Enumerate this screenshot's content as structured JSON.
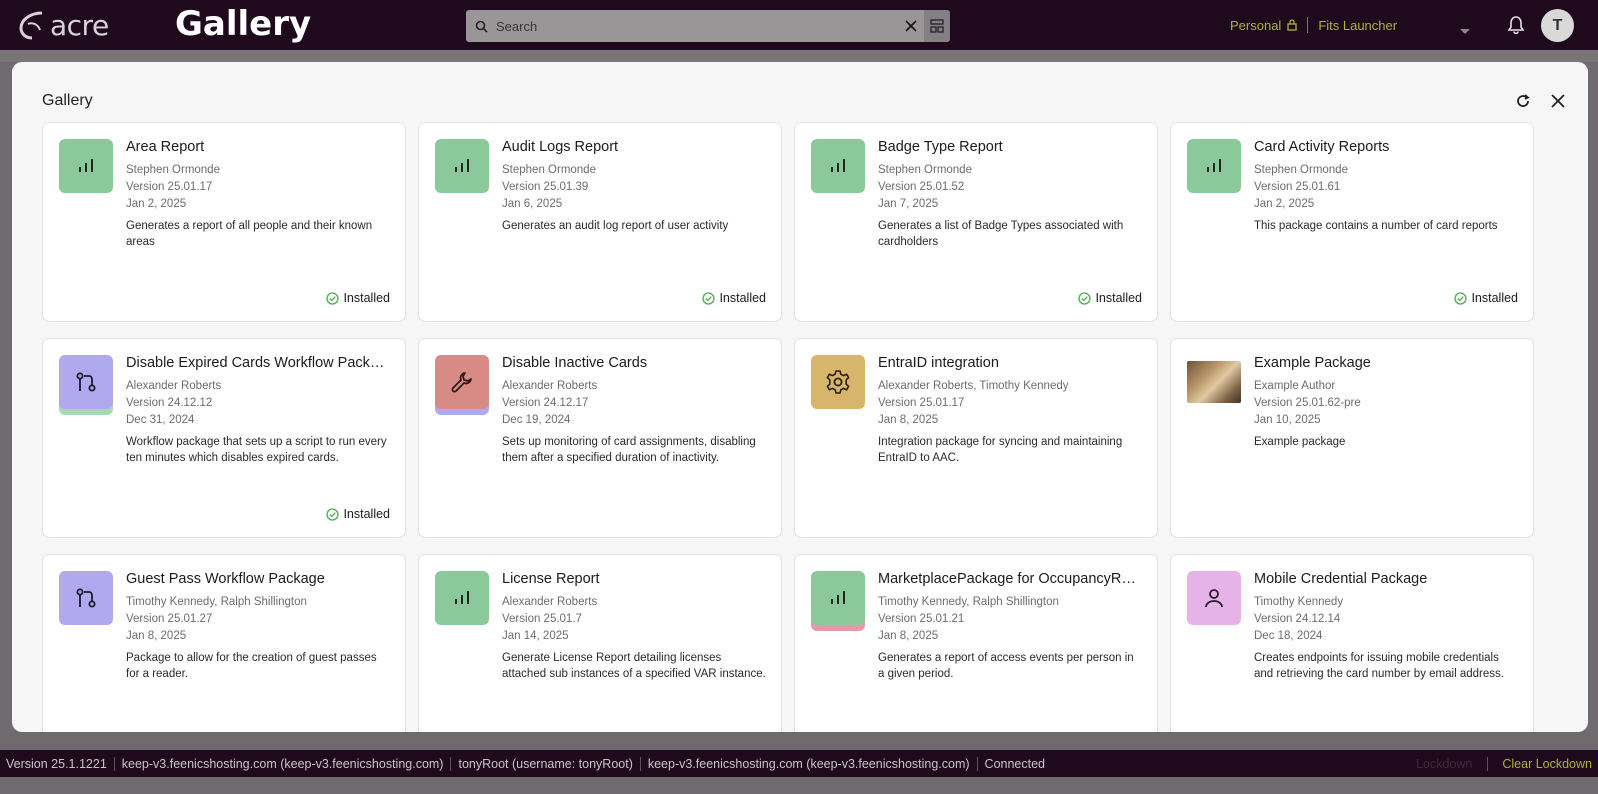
{
  "app": {
    "logo_text": "acre",
    "page_heading": "Gallery"
  },
  "search": {
    "placeholder": "Search",
    "value": ""
  },
  "tenant": {
    "scope": "Personal",
    "name": "Fits Launcher"
  },
  "user": {
    "initial": "T"
  },
  "modal": {
    "title": "Gallery"
  },
  "cards": [
    {
      "title": "Area Report",
      "author": "Stephen Ormonde",
      "version": "Version 25.01.17",
      "date": "Jan 2, 2025",
      "description": "Generates a report of all people and their known areas",
      "status": "Installed",
      "icon": "chart-bars-icon",
      "color": "#8cc99a",
      "stack_color": ""
    },
    {
      "title": "Audit Logs Report",
      "author": "Stephen Ormonde",
      "version": "Version 25.01.39",
      "date": "Jan 6, 2025",
      "description": "Generates an audit log report of user activity",
      "status": "Installed",
      "icon": "chart-bars-icon",
      "color": "#8cc99a",
      "stack_color": ""
    },
    {
      "title": "Badge Type Report",
      "author": "Stephen Ormonde",
      "version": "Version 25.01.52",
      "date": "Jan 7, 2025",
      "description": "Generates a list of Badge Types associated with cardholders",
      "status": "Installed",
      "icon": "chart-bars-icon",
      "color": "#8cc99a",
      "stack_color": ""
    },
    {
      "title": "Card Activity Reports",
      "author": "Stephen Ormonde",
      "version": "Version 25.01.61",
      "date": "Jan 2, 2025",
      "description": "This package contains a number of card reports",
      "status": "Installed",
      "icon": "chart-bars-icon",
      "color": "#8cc99a",
      "stack_color": ""
    },
    {
      "title": "Disable Expired Cards Workflow Pack…",
      "author": "Alexander Roberts",
      "version": "Version 24.12.12",
      "date": "Dec 31, 2024",
      "description": "Workflow package that sets up a script to run every ten minutes which disables expired cards.",
      "status": "Installed",
      "icon": "workflow-icon",
      "color": "#b1a9f0",
      "stack_color": "#a9d8b7"
    },
    {
      "title": "Disable Inactive Cards",
      "author": "Alexander Roberts",
      "version": "Version 24.12.17",
      "date": "Dec 19, 2024",
      "description": "Sets up monitoring of card assignments, disabling them after a specified duration of inactivity.",
      "status": "",
      "icon": "wrench-icon",
      "color": "#d88a85",
      "stack_color": "#b1a9f0"
    },
    {
      "title": "EntraID integration",
      "author": "Alexander Roberts, Timothy Kennedy",
      "version": "Version 25.01.17",
      "date": "Jan 8, 2025",
      "description": "Integration package for syncing and maintaining EntraID to AAC.",
      "status": "",
      "icon": "gear-icon",
      "color": "#d7b56a",
      "stack_color": ""
    },
    {
      "title": "Example Package",
      "author": "Example Author",
      "version": "Version 25.01.62-pre",
      "date": "Jan 10, 2025",
      "description": "Example package",
      "status": "",
      "icon": "photo-thumbnail",
      "color": "",
      "stack_color": ""
    },
    {
      "title": "Guest Pass Workflow Package",
      "author": "Timothy Kennedy, Ralph Shillington",
      "version": "Version 25.01.27",
      "date": "Jan 8, 2025",
      "description": "Package to allow for the creation of guest passes for a reader.",
      "status": "",
      "icon": "workflow-icon",
      "color": "#b1a9f0",
      "stack_color": ""
    },
    {
      "title": "License Report",
      "author": "Alexander Roberts",
      "version": "Version 25.01.7",
      "date": "Jan 14, 2025",
      "description": "Generate License Report detailing licenses attached sub instances of a specified VAR instance.",
      "status": "",
      "icon": "chart-bars-icon",
      "color": "#8cc99a",
      "stack_color": ""
    },
    {
      "title": "MarketplacePackage for OccupancyR…",
      "author": "Timothy Kennedy, Ralph Shillington",
      "version": "Version 25.01.21",
      "date": "Jan 8, 2025",
      "description": "Generates a report of access events per person in a given period.",
      "status": "",
      "icon": "chart-bars-icon",
      "color": "#8cc99a",
      "stack_color": "#e69aa8"
    },
    {
      "title": "Mobile Credential Package",
      "author": "Timothy Kennedy",
      "version": "Version 24.12.14",
      "date": "Dec 18, 2024",
      "description": "Creates endpoints for issuing mobile credentials and retrieving the card number by email address.",
      "status": "",
      "icon": "person-icon",
      "color": "#e5b3e8",
      "stack_color": ""
    }
  ],
  "statusbar": {
    "version": "Version 25.1.1221",
    "host1": "keep-v3.feenicshosting.com (keep-v3.feenicshosting.com)",
    "user": "tonyRoot (username: tonyRoot)",
    "host2": "keep-v3.feenicshosting.com (keep-v3.feenicshosting.com)",
    "connection": "Connected",
    "lockdown": "Lockdown",
    "clear_lockdown": "Clear Lockdown"
  },
  "colors": {
    "topbar": "#1f0a1d",
    "accent": "#a8b33a",
    "installed_check": "#4caf50"
  }
}
